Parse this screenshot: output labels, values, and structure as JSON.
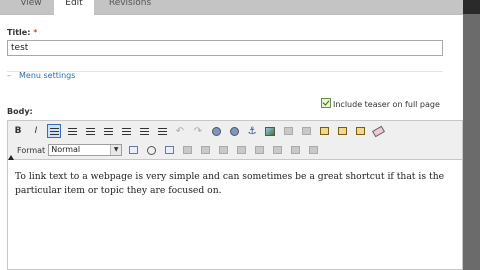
{
  "tabs": [
    {
      "label": "View",
      "active": false
    },
    {
      "label": "Edit",
      "active": true
    },
    {
      "label": "Revisions",
      "active": false
    }
  ],
  "title_field": {
    "label": "Title:",
    "required_marker": "*",
    "value": "test"
  },
  "menu_settings": {
    "toggle": "–",
    "label": "Menu settings"
  },
  "teaser": {
    "label": "Include teaser on full page",
    "checked": true
  },
  "body_field": {
    "label": "Body:"
  },
  "editor": {
    "toolbar_row1": [
      "bold-icon",
      "italic-icon",
      "align-left-icon",
      "align-center-icon",
      "align-right-icon",
      "bulleted-list-icon",
      "numbered-list-icon",
      "outdent-icon",
      "indent-icon",
      "undo-icon",
      "redo-icon",
      "link-icon",
      "unlink-icon",
      "anchor-icon",
      "image-icon",
      "cut-icon",
      "copy-icon",
      "paste-icon",
      "paste-text-icon",
      "paste-word-icon",
      "eraser-icon"
    ],
    "bold": "B",
    "italic": "I",
    "format_label": "Format",
    "format_value": "Normal",
    "content": "To link text to a webpage is very simple and can sometimes be a great shortcut if that is the particular item or topic they are focused on."
  },
  "colors": {
    "link": "#2a6fb0",
    "active_tab": "#ffffff",
    "tab_bar": "#c4c4c4",
    "required": "#d00000"
  }
}
